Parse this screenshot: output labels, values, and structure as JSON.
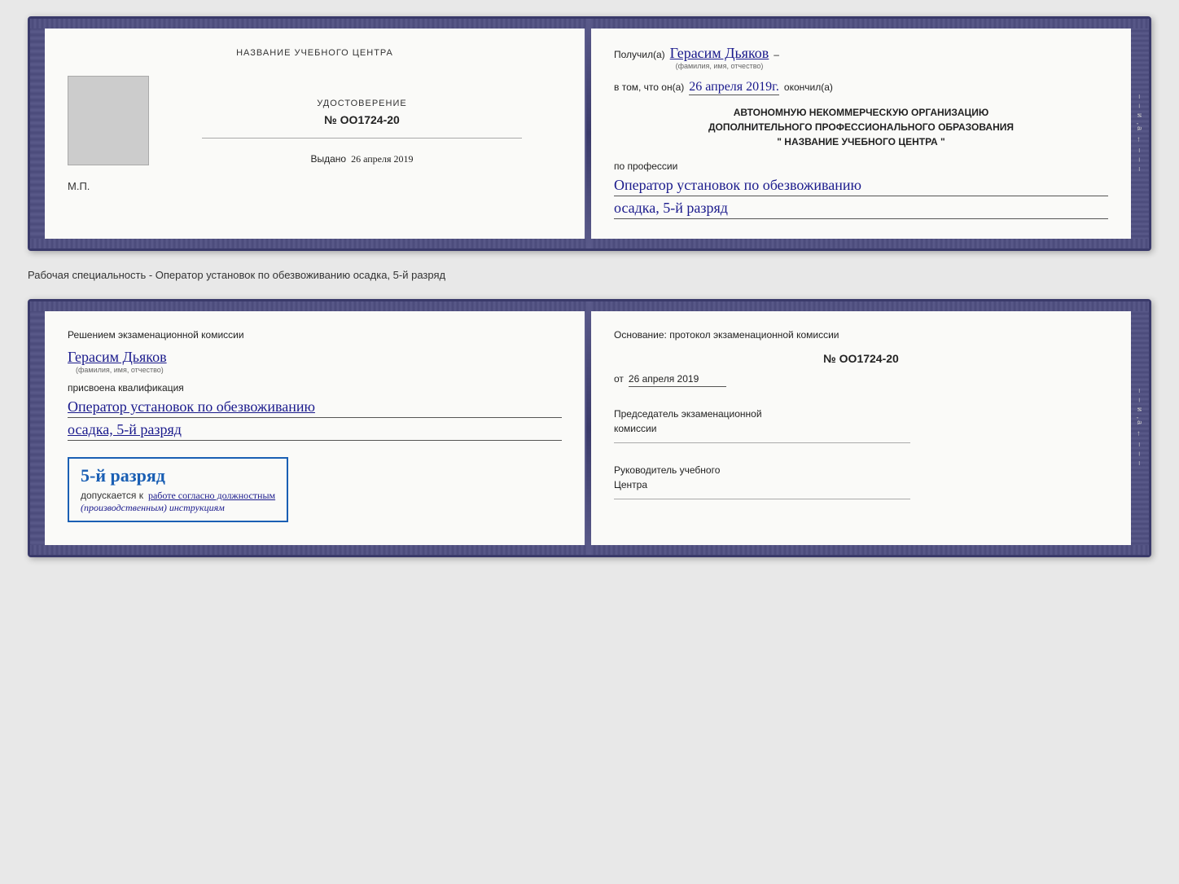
{
  "doc1": {
    "left": {
      "title": "НАЗВАНИЕ УЧЕБНОГО ЦЕНТРА",
      "cert_label": "УДОСТОВЕРЕНИЕ",
      "cert_number": "№ OO1724-20",
      "issued_label": "Выдано",
      "issued_date": "26 апреля 2019",
      "mp_label": "М.П."
    },
    "right": {
      "received_label": "Получил(а)",
      "recipient_name": "Герасим Дьяков",
      "recipient_sublabel": "(фамилия, имя, отчество)",
      "dash": "–",
      "in_that_label": "в том, что он(а)",
      "date_value": "26 апреля 2019г.",
      "finished_label": "окончил(а)",
      "org_line1": "АВТОНОМНУЮ НЕКОММЕРЧЕСКУЮ ОРГАНИЗАЦИЮ",
      "org_line2": "ДОПОЛНИТЕЛЬНОГО ПРОФЕССИОНАЛЬНОГО ОБРАЗОВАНИЯ",
      "org_line3": "\" НАЗВАНИЕ УЧЕБНОГО ЦЕНТРА \"",
      "profession_label": "по профессии",
      "profession_value": "Оператор установок по обезвоживанию",
      "rank_value": "осадка, 5-й разряд"
    }
  },
  "between_label": "Рабочая специальность - Оператор установок по обезвоживанию осадка, 5-й разряд",
  "doc2": {
    "left": {
      "decision_label": "Решением экзаменационной комиссии",
      "person_name": "Герасим Дьяков",
      "person_sublabel": "(фамилия, имя, отчество)",
      "assigned_label": "присвоена квалификация",
      "qualification_line1": "Оператор установок по обезвоживанию",
      "qualification_line2": "осадка, 5-й разряд",
      "stamp_rank": "5-й разряд",
      "allowed_label": "допускается к",
      "allowed_value": "работе согласно должностным",
      "allowed_value2": "(производственным) инструкциям"
    },
    "right": {
      "basis_label": "Основание: протокол экзаменационной комиссии",
      "number_value": "№ OO1724-20",
      "date_label": "от",
      "date_value": "26 апреля 2019",
      "chairman_label": "Председатель экзаменационной",
      "chairman_label2": "комиссии",
      "director_label": "Руководитель учебного",
      "director_label2": "Центра"
    }
  },
  "right_margin_ticks": [
    "–",
    "–",
    "–",
    "и",
    ",а",
    "←",
    "–",
    "–",
    "–"
  ]
}
